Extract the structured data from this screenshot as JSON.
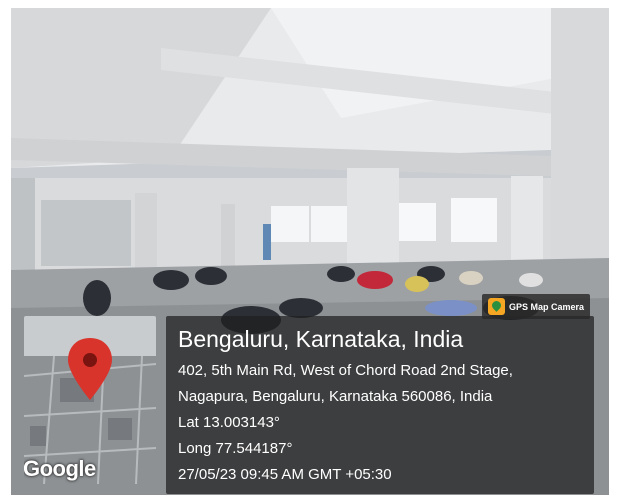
{
  "stamp": {
    "app_badge": "GPS Map Camera",
    "map_logo": "Google",
    "place_title": "Bengaluru, Karnataka, India",
    "address_line1": "402, 5th Main Rd, West of Chord Road 2nd Stage,",
    "address_line2": "Nagapura, Bengaluru, Karnataka 560086, India",
    "latitude": "Lat 13.003143°",
    "longitude": "Long 77.544187°",
    "datetime": "27/05/23 09:45 AM GMT +05:30",
    "pin_color": "#d8342c"
  }
}
